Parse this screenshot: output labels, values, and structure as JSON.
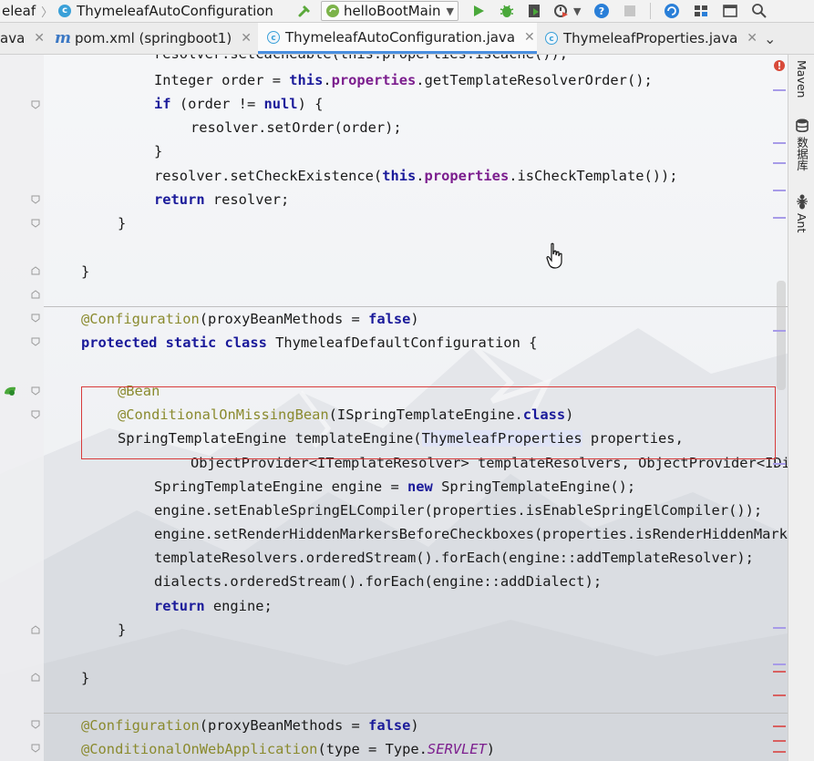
{
  "navbar": {
    "crumb_left": "eleaf",
    "crumb_class": "ThymeleafAutoConfiguration",
    "run_config": "helloBootMain"
  },
  "tabs": [
    {
      "label": "ava",
      "active": false
    },
    {
      "label": "pom.xml (springboot1)",
      "active": false
    },
    {
      "label": "ThymeleafAutoConfiguration.java",
      "active": true
    },
    {
      "label": "ThymeleafProperties.java",
      "active": false
    }
  ],
  "right_panel": {
    "maven": "Maven",
    "database": "数据库",
    "ant": "Ant"
  },
  "code": {
    "l0": "resolver.setCacheable(this.properties.isCache());",
    "l1_a": "Integer order = ",
    "l1_kw": "this",
    "l1_b": ".",
    "l1_pf": "properties",
    "l1_c": ".getTemplateResolverOrder();",
    "l2_kw1": "if",
    "l2_a": " (order != ",
    "l2_kw2": "null",
    "l2_b": ") {",
    "l3": "resolver.setOrder(order);",
    "l4": "}",
    "l5_a": "resolver.setCheckExistence(",
    "l5_kw": "this",
    "l5_b": ".",
    "l5_pf": "properties",
    "l5_c": ".isCheckTemplate());",
    "l6_kw": "return",
    "l6_a": " resolver;",
    "l7": "}",
    "l9": "}",
    "l11_an": "@Configuration",
    "l11_a": "(proxyBeanMethods = ",
    "l11_kw": "false",
    "l11_b": ")",
    "l12_kw": "protected static class",
    "l12_a": " ThymeleafDefaultConfiguration {",
    "l14_an": "@Bean",
    "l15_an": "@ConditionalOnMissingBean",
    "l15_a": "(ISpringTemplateEngine.",
    "l15_kw": "class",
    "l15_b": ")",
    "l16_a": "SpringTemplateEngine templateEngine(",
    "l16_hl": "ThymeleafProperties",
    "l16_b": " properties,",
    "l17": "ObjectProvider<ITemplateResolver> templateResolvers, ObjectProvider<IDialect> dialects) {",
    "l18_a": "SpringTemplateEngine engine = ",
    "l18_kw": "new",
    "l18_b": " SpringTemplateEngine();",
    "l19": "engine.setEnableSpringELCompiler(properties.isEnableSpringElCompiler());",
    "l20": "engine.setRenderHiddenMarkersBeforeCheckboxes(properties.isRenderHiddenMarkersBeforeCheckboxes());",
    "l21": "templateResolvers.orderedStream().forEach(engine::addTemplateResolver);",
    "l22": "dialects.orderedStream().forEach(engine::addDialect);",
    "l23_kw": "return",
    "l23_a": " engine;",
    "l24": "}",
    "l26": "}",
    "l28_an": "@Configuration",
    "l28_a": "(proxyBeanMethods = ",
    "l28_kw": "false",
    "l28_b": ")",
    "l29_an": "@ConditionalOnWebApplication",
    "l29_a": "(type = Type.",
    "l29_it": "SERVLET",
    "l29_b": ")"
  },
  "colors": {
    "keyword": "#1a1a9a",
    "annotation": "#8a8a2e",
    "field": "#7c1e8e",
    "highlight_box": "#d83b3b",
    "active_tab_underline": "#4a8fe0"
  }
}
